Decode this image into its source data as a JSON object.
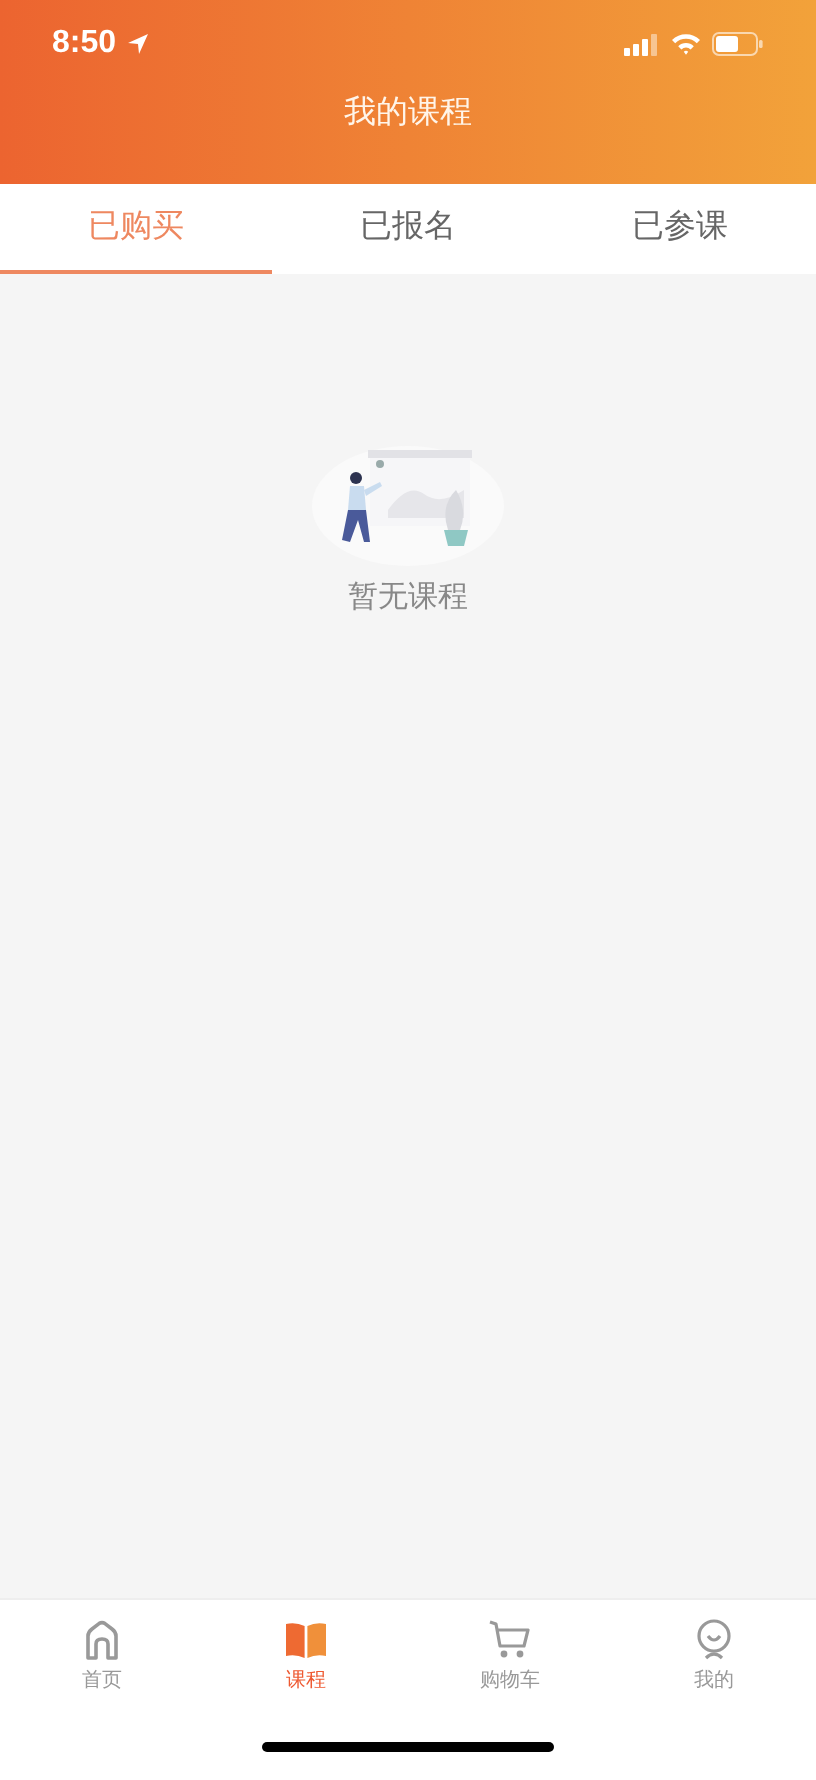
{
  "status_bar": {
    "time": "8:50"
  },
  "header": {
    "title": "我的课程"
  },
  "tabs": [
    {
      "label": "已购买",
      "selected": true
    },
    {
      "label": "已报名",
      "selected": false
    },
    {
      "label": "已参课",
      "selected": false
    }
  ],
  "empty_state": {
    "message": "暂无课程"
  },
  "bottom_nav": [
    {
      "label": "首页",
      "kind": "home",
      "selected": false
    },
    {
      "label": "课程",
      "kind": "book",
      "selected": true
    },
    {
      "label": "购物车",
      "kind": "cart",
      "selected": false
    },
    {
      "label": "我的",
      "kind": "profile",
      "selected": false
    }
  ]
}
